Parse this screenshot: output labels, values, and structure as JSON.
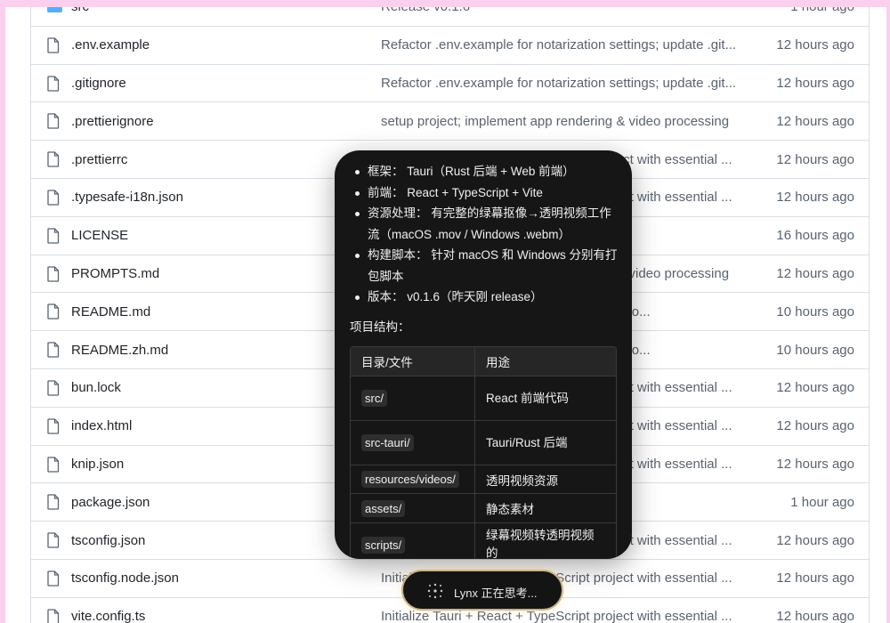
{
  "files": [
    {
      "name": "src",
      "type": "folder",
      "message": "Release v0.1.6",
      "time": "1 hour ago"
    },
    {
      "name": ".env.example",
      "type": "file",
      "message": "Refactor .env.example for notarization settings; update .git...",
      "time": "12 hours ago"
    },
    {
      "name": ".gitignore",
      "type": "file",
      "message": "Refactor .env.example for notarization settings; update .git...",
      "time": "12 hours ago"
    },
    {
      "name": ".prettierignore",
      "type": "file",
      "message": "setup project; implement app rendering & video processing",
      "time": "12 hours ago"
    },
    {
      "name": ".prettierrc",
      "type": "file",
      "message": "Initialize Tauri + React + TypeScript project with essential ...",
      "time": "12 hours ago"
    },
    {
      "name": ".typesafe-i18n.json",
      "type": "file",
      "message": "Initialize Tauri + React + TypeScript project with essential ...",
      "time": "12 hours ago"
    },
    {
      "name": "LICENSE",
      "type": "file",
      "message": "",
      "time": "16 hours ago"
    },
    {
      "name": "PROMPTS.md",
      "type": "file",
      "message": "setup project; implement app rendering & video processing",
      "time": "12 hours ago"
    },
    {
      "name": "README.md",
      "type": "file",
      "message": "Update README files to enhance instructio...",
      "time": "10 hours ago"
    },
    {
      "name": "README.zh.md",
      "type": "file",
      "message": "Update README files to enhance instructio...",
      "time": "10 hours ago"
    },
    {
      "name": "bun.lock",
      "type": "file",
      "message": "Initialize Tauri + React + TypeScript project with essential ...",
      "time": "12 hours ago"
    },
    {
      "name": "index.html",
      "type": "file",
      "message": "Initialize Tauri + React + TypeScript project with essential ...",
      "time": "12 hours ago"
    },
    {
      "name": "knip.json",
      "type": "file",
      "message": "Initialize Tauri + React + TypeScript project with essential ...",
      "time": "12 hours ago"
    },
    {
      "name": "package.json",
      "type": "file",
      "message": "",
      "time": "1 hour ago"
    },
    {
      "name": "tsconfig.json",
      "type": "file",
      "message": "Initialize Tauri + React + TypeScript project with essential ...",
      "time": "12 hours ago"
    },
    {
      "name": "tsconfig.node.json",
      "type": "file",
      "message": "Initialize Tauri + React + TypeScript project with essential ...",
      "time": "12 hours ago"
    },
    {
      "name": "vite.config.ts",
      "type": "file",
      "message": "Initialize Tauri + React + TypeScript project with essential ...",
      "time": "12 hours ago"
    }
  ],
  "popup": {
    "bullets": [
      {
        "key": "框架：",
        "value": "Tauri（Rust 后端 + Web 前端）"
      },
      {
        "key": "前端：",
        "value": "React + TypeScript + Vite"
      },
      {
        "key": "资源处理：",
        "value": "有完整的绿幕抠像→透明视频工作流（macOS .mov / Windows .webm）"
      },
      {
        "key": "构建脚本：",
        "value": "针对 macOS 和 Windows 分别有打包脚本"
      },
      {
        "key": "版本：",
        "value": "v0.1.6（昨天刚 release）"
      }
    ],
    "section_title": "项目结构：",
    "table": {
      "headers": [
        "目录/文件",
        "用途"
      ],
      "rows": [
        [
          "src/",
          "React 前端代码"
        ],
        [
          "src-tauri/",
          "Tauri/Rust 后端"
        ],
        [
          "resources/videos/",
          "透明视频资源"
        ],
        [
          "assets/",
          "静态素材"
        ],
        [
          "scripts/",
          "绿幕视频转透明视频的"
        ]
      ]
    }
  },
  "thinking": {
    "text": "Lynx 正在思考..."
  },
  "colors": {
    "page_border": "#fbd0ee",
    "folder": "#54aeff",
    "popup_bg": "#161616",
    "pill_border": "#c9b58a"
  }
}
